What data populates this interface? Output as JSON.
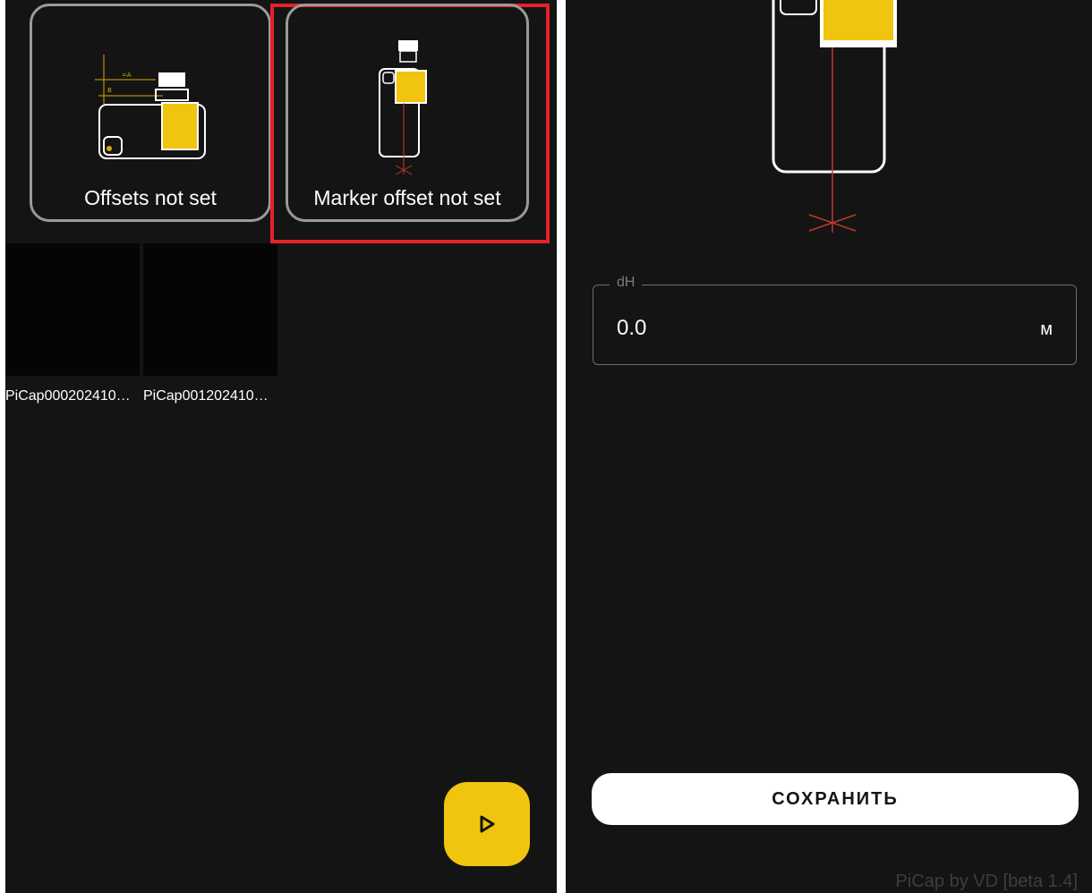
{
  "left_screen": {
    "cards": [
      {
        "label": "Offsets not set",
        "icon": "camera-offset-diagram-icon"
      },
      {
        "label": "Marker offset not set",
        "icon": "marker-offset-diagram-icon"
      }
    ],
    "captures": [
      {
        "label": "PiCap000202410…"
      },
      {
        "label": "PiCap001202410…"
      }
    ],
    "fab": {
      "icon": "play-icon"
    }
  },
  "right_screen": {
    "field": {
      "label": "dH",
      "value": "0.0",
      "unit": "м"
    },
    "save_button": "СОХРАНИТЬ",
    "footer": "PiCap by VD [beta 1.4]"
  },
  "colors": {
    "background": "#141414",
    "accent_yellow": "#f1c40f",
    "highlight_red": "#e5222a",
    "card_border": "#9a9a9a"
  }
}
